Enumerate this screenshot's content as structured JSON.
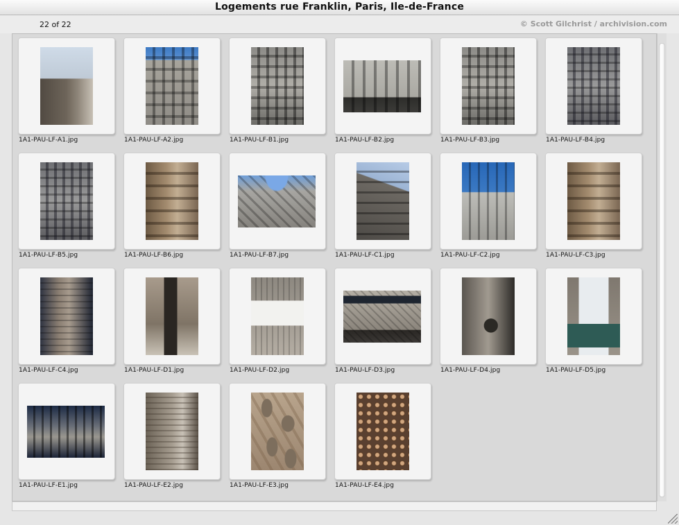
{
  "window": {
    "title": "Logements rue Franklin, Paris, Ile-de-France"
  },
  "info": {
    "count": "22 of 22",
    "copyright": "© Scott Gilchrist / archivision.com"
  },
  "thumbnails": [
    {
      "file": "1A1-PAU-LF-A1.jpg",
      "style": "sky-street",
      "orientation": "portrait"
    },
    {
      "file": "1A1-PAU-LF-A2.jpg",
      "style": "facade-blue",
      "orientation": "portrait"
    },
    {
      "file": "1A1-PAU-LF-B1.jpg",
      "style": "facade-grey",
      "orientation": "portrait"
    },
    {
      "file": "1A1-PAU-LF-B2.jpg",
      "style": "facade-wide",
      "orientation": "landscape"
    },
    {
      "file": "1A1-PAU-LF-B3.jpg",
      "style": "facade-grey",
      "orientation": "portrait"
    },
    {
      "file": "1A1-PAU-LF-B4.jpg",
      "style": "facade-dark",
      "orientation": "portrait"
    },
    {
      "file": "1A1-PAU-LF-B5.jpg",
      "style": "facade-dark",
      "orientation": "portrait"
    },
    {
      "file": "1A1-PAU-LF-B6.jpg",
      "style": "facade-brown",
      "orientation": "portrait"
    },
    {
      "file": "1A1-PAU-LF-B7.jpg",
      "style": "upward",
      "orientation": "landscape"
    },
    {
      "file": "1A1-PAU-LF-C1.jpg",
      "style": "sky-corner",
      "orientation": "portrait"
    },
    {
      "file": "1A1-PAU-LF-C2.jpg",
      "style": "sky-balcony",
      "orientation": "portrait"
    },
    {
      "file": "1A1-PAU-LF-C3.jpg",
      "style": "facade-brown",
      "orientation": "portrait"
    },
    {
      "file": "1A1-PAU-LF-C4.jpg",
      "style": "stone-dark",
      "orientation": "portrait"
    },
    {
      "file": "1A1-PAU-LF-D1.jpg",
      "style": "doorway",
      "orientation": "portrait"
    },
    {
      "file": "1A1-PAU-LF-D2.jpg",
      "style": "window-panel",
      "orientation": "portrait"
    },
    {
      "file": "1A1-PAU-LF-D3.jpg",
      "style": "ironwork",
      "orientation": "landscape"
    },
    {
      "file": "1A1-PAU-LF-D4.jpg",
      "style": "corbel",
      "orientation": "portrait"
    },
    {
      "file": "1A1-PAU-LF-D5.jpg",
      "style": "green-window",
      "orientation": "portrait"
    },
    {
      "file": "1A1-PAU-LF-E1.jpg",
      "style": "balcony-blue",
      "orientation": "landscape"
    },
    {
      "file": "1A1-PAU-LF-E2.jpg",
      "style": "column-ornate",
      "orientation": "portrait"
    },
    {
      "file": "1A1-PAU-LF-E3.jpg",
      "style": "flower-tile",
      "orientation": "portrait"
    },
    {
      "file": "1A1-PAU-LF-E4.jpg",
      "style": "disc-tile",
      "orientation": "portrait"
    }
  ],
  "colors": {
    "panel": "#d9d9d9",
    "card": "#f4f4f4",
    "copyright": "#9a9a9a"
  }
}
